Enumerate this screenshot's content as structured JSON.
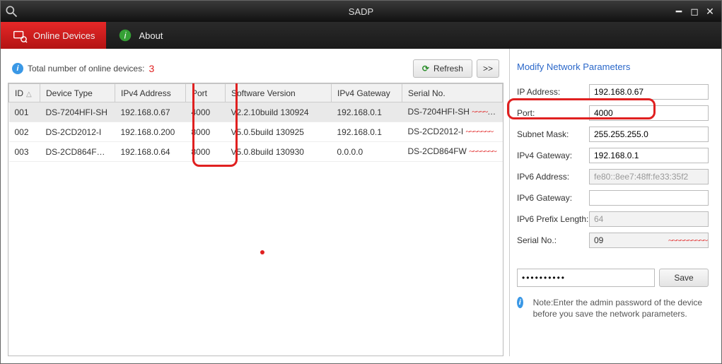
{
  "app_title": "SADP",
  "tabs": [
    {
      "label": "Online Devices",
      "active": true
    },
    {
      "label": "About",
      "active": false
    }
  ],
  "total_label": "Total number of online devices:",
  "total_count": "3",
  "buttons": {
    "refresh": "Refresh",
    "more": ">>"
  },
  "columns": [
    "ID",
    "Device Type",
    "IPv4 Address",
    "Port",
    "Software Version",
    "IPv4 Gateway",
    "Serial No."
  ],
  "rows": [
    {
      "id": "001",
      "type": "DS-7204HFI-SH",
      "ipv4": "192.168.0.67",
      "port": "4000",
      "sw": "V2.2.10build 130924",
      "gw": "192.168.0.1",
      "serial": "DS-7204HFI-SH",
      "redacted": true,
      "selected": true
    },
    {
      "id": "002",
      "type": "DS-2CD2012-I",
      "ipv4": "192.168.0.200",
      "port": "8000",
      "sw": "V5.0.5build 130925",
      "gw": "192.168.0.1",
      "serial": "DS-2CD2012-I",
      "redacted": true,
      "selected": false
    },
    {
      "id": "003",
      "type": "DS-2CD864FW...",
      "ipv4": "192.168.0.64",
      "port": "8000",
      "sw": "V5.0.8build 130930",
      "gw": "0.0.0.0",
      "serial": "DS-2CD864FW",
      "redacted": true,
      "selected": false
    }
  ],
  "right": {
    "title": "Modify Network Parameters",
    "fields": {
      "ip_label": "IP Address:",
      "ip_value": "192.168.0.67",
      "port_label": "Port:",
      "port_value": "4000",
      "subnet_label": "Subnet Mask:",
      "subnet_value": "255.255.255.0",
      "gw_label": "IPv4 Gateway:",
      "gw_value": "192.168.0.1",
      "ipv6_label": "IPv6 Address:",
      "ipv6_value": "fe80::8ee7:48ff:fe33:35f2",
      "ipv6gw_label": "IPv6 Gateway:",
      "ipv6gw_value": "",
      "ipv6plen_label": "IPv6 Prefix Length:",
      "ipv6plen_value": "64",
      "serial_label": "Serial No.:",
      "serial_value": "09"
    },
    "password": "••••••••••",
    "save": "Save",
    "note": "Note:Enter the admin password of the device before you save the network parameters."
  }
}
